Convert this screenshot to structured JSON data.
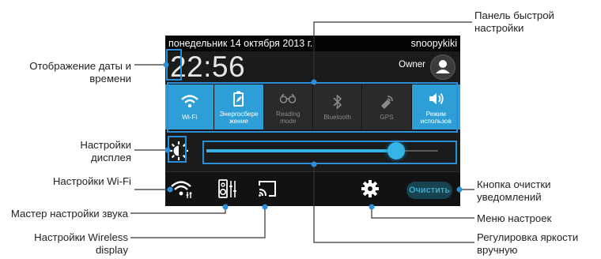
{
  "status_bar": {
    "date": "понедельник 14 октября 2013 г.",
    "username": "snoopykiki"
  },
  "header": {
    "time": "22:56",
    "owner": "Owner"
  },
  "toggles": [
    {
      "label": "Wi-Fi",
      "icon": "wifi-icon",
      "state": "on"
    },
    {
      "label": "Энергосбере жение",
      "icon": "power-saving-icon",
      "state": "on"
    },
    {
      "label": "Reading mode",
      "icon": "glasses-icon",
      "state": "off"
    },
    {
      "label": "Bluetooth",
      "icon": "bluetooth-icon",
      "state": "off"
    },
    {
      "label": "GPS",
      "icon": "gps-icon",
      "state": "off"
    },
    {
      "label": "Режим использов",
      "icon": "sound-mode-icon",
      "state": "on"
    }
  ],
  "brightness": {
    "value_fraction": 0.82
  },
  "toolbar": {
    "clear_label": "Очистить"
  },
  "annotations": {
    "quick_settings": "Панель быстрой настройки",
    "date_time": "Отображение даты и времени",
    "display_settings": "Настройки дисплея",
    "wifi_settings": "Настройки Wi-Fi",
    "sound_wizard": "Мастер настройки звука",
    "wireless_display": "Настройки Wireless display",
    "clear_button": "Кнопка очистки уведомлений",
    "settings_menu": "Меню настроек",
    "manual_brightness": "Регулировка яркости вручную"
  },
  "colors": {
    "accent": "#2d9fd6",
    "slider": "#34b5e5",
    "highlight": "#2a8fd8"
  }
}
